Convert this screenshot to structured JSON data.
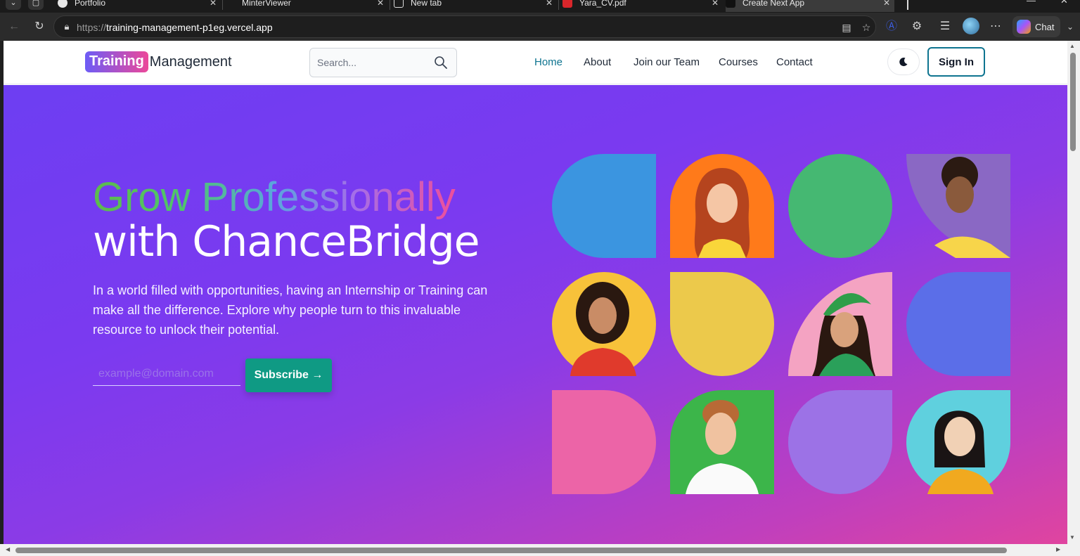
{
  "browser": {
    "tabs": [
      {
        "title": "Portfolio"
      },
      {
        "title": "MinterViewer"
      },
      {
        "title": "New tab"
      },
      {
        "title": "Yara_CV.pdf"
      },
      {
        "title": "Create Next App"
      }
    ],
    "url_scheme": "https://",
    "url_host": "training-management-p1eg.vercel.app",
    "chat_label": "Chat"
  },
  "header": {
    "logo_highlight": "Training",
    "logo_rest": "Management",
    "search_placeholder": "Search...",
    "nav": [
      "Home",
      "About",
      "Join our Team",
      "Courses",
      "Contact"
    ],
    "active_nav": "Home",
    "signin_label": "Sign In"
  },
  "hero": {
    "title_line1": "Grow Professionally",
    "title_line2": "with ChanceBridge",
    "description": "In a world filled with opportunities, having an Internship or Training can make all the difference. Explore why people turn to this invaluable resource to unlock their potential.",
    "email_placeholder": "example@domain.com",
    "subscribe_label": "Subscribe →"
  },
  "grid": {
    "tiles": [
      {
        "type": "shape",
        "color": "#3b95e0",
        "shape": "drop-tl"
      },
      {
        "type": "photo",
        "bg": "#ff7a1a",
        "shape": "arch",
        "person": "woman-red-hair-yellow-top"
      },
      {
        "type": "shape",
        "color": "#45b872",
        "shape": "circle"
      },
      {
        "type": "photo",
        "bg": "#8a68c4",
        "shape": "quarter-br",
        "person": "man-curly-hair-yellow-shirt"
      },
      {
        "type": "photo",
        "bg": "#f7c23a",
        "shape": "circle",
        "person": "woman-curly-hair-red-sweater"
      },
      {
        "type": "shape",
        "color": "#ecc94b",
        "shape": "drop-bottom"
      },
      {
        "type": "photo",
        "bg": "#f4a3c2",
        "shape": "quarter-tr",
        "person": "woman-green-hat"
      },
      {
        "type": "shape",
        "color": "#5b6ee8",
        "shape": "drop-tl-round"
      },
      {
        "type": "shape",
        "color": "#ec64a7",
        "shape": "drop-right"
      },
      {
        "type": "photo",
        "bg": "#3cb54a",
        "shape": "leaf",
        "person": "man-red-hair-white-shirt"
      },
      {
        "type": "shape",
        "color": "#9c72e6",
        "shape": "drop-tr"
      },
      {
        "type": "photo",
        "bg": "#5fd0de",
        "shape": "drop-tr",
        "person": "woman-black-hair-yellow-top"
      }
    ]
  }
}
